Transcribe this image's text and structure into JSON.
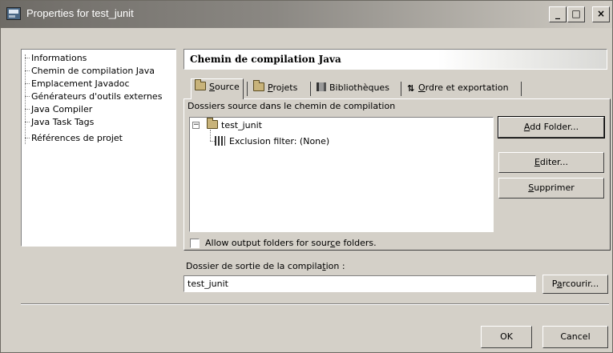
{
  "window": {
    "title": "Properties for test_junit"
  },
  "tree": {
    "items": [
      "Informations",
      "Chemin de compilation Java",
      "Emplacement Javadoc",
      "Générateurs d'outils externes",
      "Java Compiler",
      "Java Task Tags",
      "Références de projet"
    ]
  },
  "page": {
    "title": "Chemin de compilation Java"
  },
  "tabs": [
    {
      "label": "Source",
      "mnemonic": "S",
      "rest": "ource",
      "icon": "folder-icon",
      "active": true
    },
    {
      "label": "Projets",
      "mnemonic": "P",
      "rest": "rojets",
      "icon": "folder-icon",
      "active": false
    },
    {
      "label": "Bibliothèques",
      "mnemonic": "",
      "rest": "Bibliothèques",
      "icon": "books-icon",
      "active": false
    },
    {
      "label": "Ordre et exportation",
      "mnemonic": "O",
      "rest": "rdre et exportation",
      "icon": "sort-icon",
      "active": false
    }
  ],
  "source": {
    "list_label": "Dossiers source dans le chemin de compilation",
    "root": "test_junit",
    "child": "Exclusion filter: (None)",
    "buttons": {
      "add": {
        "m": "A",
        "rest": "dd Folder..."
      },
      "edit": {
        "m": "E",
        "rest": "diter..."
      },
      "remove": {
        "m": "S",
        "rest": "upprimer"
      }
    },
    "checkbox_label_a": "Allow output folders for sour",
    "checkbox_label_m": "c",
    "checkbox_label_b": "e folders.",
    "checkbox_checked": false
  },
  "output": {
    "label_a": "Dossier de sortie de la compila",
    "label_m": "t",
    "label_b": "ion :",
    "value": "test_junit",
    "browse_a": "P",
    "browse_m": "a",
    "browse_b": "rcourir..."
  },
  "footer": {
    "ok": "OK",
    "cancel": "Cancel"
  }
}
